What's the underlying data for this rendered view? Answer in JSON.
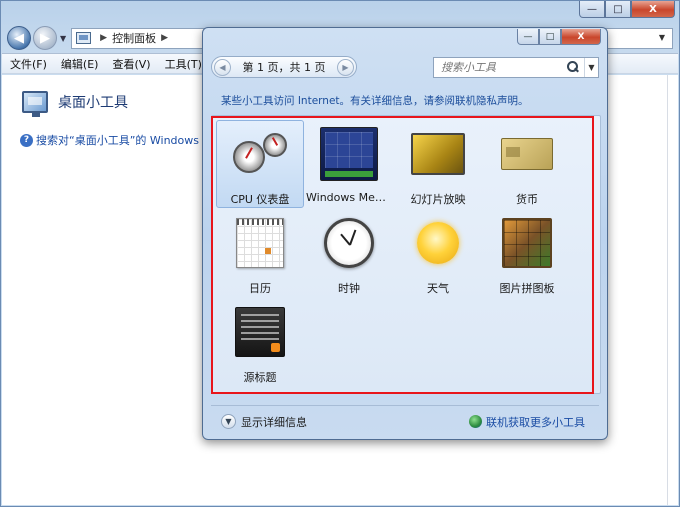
{
  "control_panel": {
    "address": {
      "path": [
        "控制面板"
      ]
    },
    "menu": [
      "文件(F)",
      "编辑(E)",
      "查看(V)",
      "工具(T)"
    ],
    "title": "桌面小工具",
    "link_text": "搜索对“桌面小工具”的 Windows 帮"
  },
  "window_controls": {
    "minimize": "—",
    "maximize": "□",
    "close": "X"
  },
  "gallery": {
    "pager_text": "第 1 页，共 1 页",
    "search_placeholder": "搜索小工具",
    "notice": "某些小工具访问 Internet。有关详细信息，请参阅联机隐私声明。",
    "gadgets": [
      {
        "name": "CPU 仪表盘",
        "icon": "cpu-meter-icon",
        "selected": true
      },
      {
        "name": "Windows Media Center",
        "icon": "media-center-icon",
        "selected": false
      },
      {
        "name": "幻灯片放映",
        "icon": "slideshow-icon",
        "selected": false
      },
      {
        "name": "货币",
        "icon": "currency-icon",
        "selected": false
      },
      {
        "name": "日历",
        "icon": "calendar-icon",
        "selected": false
      },
      {
        "name": "时钟",
        "icon": "clock-icon",
        "selected": false
      },
      {
        "name": "天气",
        "icon": "weather-icon",
        "selected": false
      },
      {
        "name": "图片拼图板",
        "icon": "puzzle-icon",
        "selected": false
      },
      {
        "name": "源标题",
        "icon": "feed-headlines-icon",
        "selected": false
      }
    ],
    "show_details": "显示详细信息",
    "get_more": "联机获取更多小工具"
  },
  "accent_colors": {
    "highlight_frame": "#e8151b",
    "link": "#1a4ca4"
  }
}
